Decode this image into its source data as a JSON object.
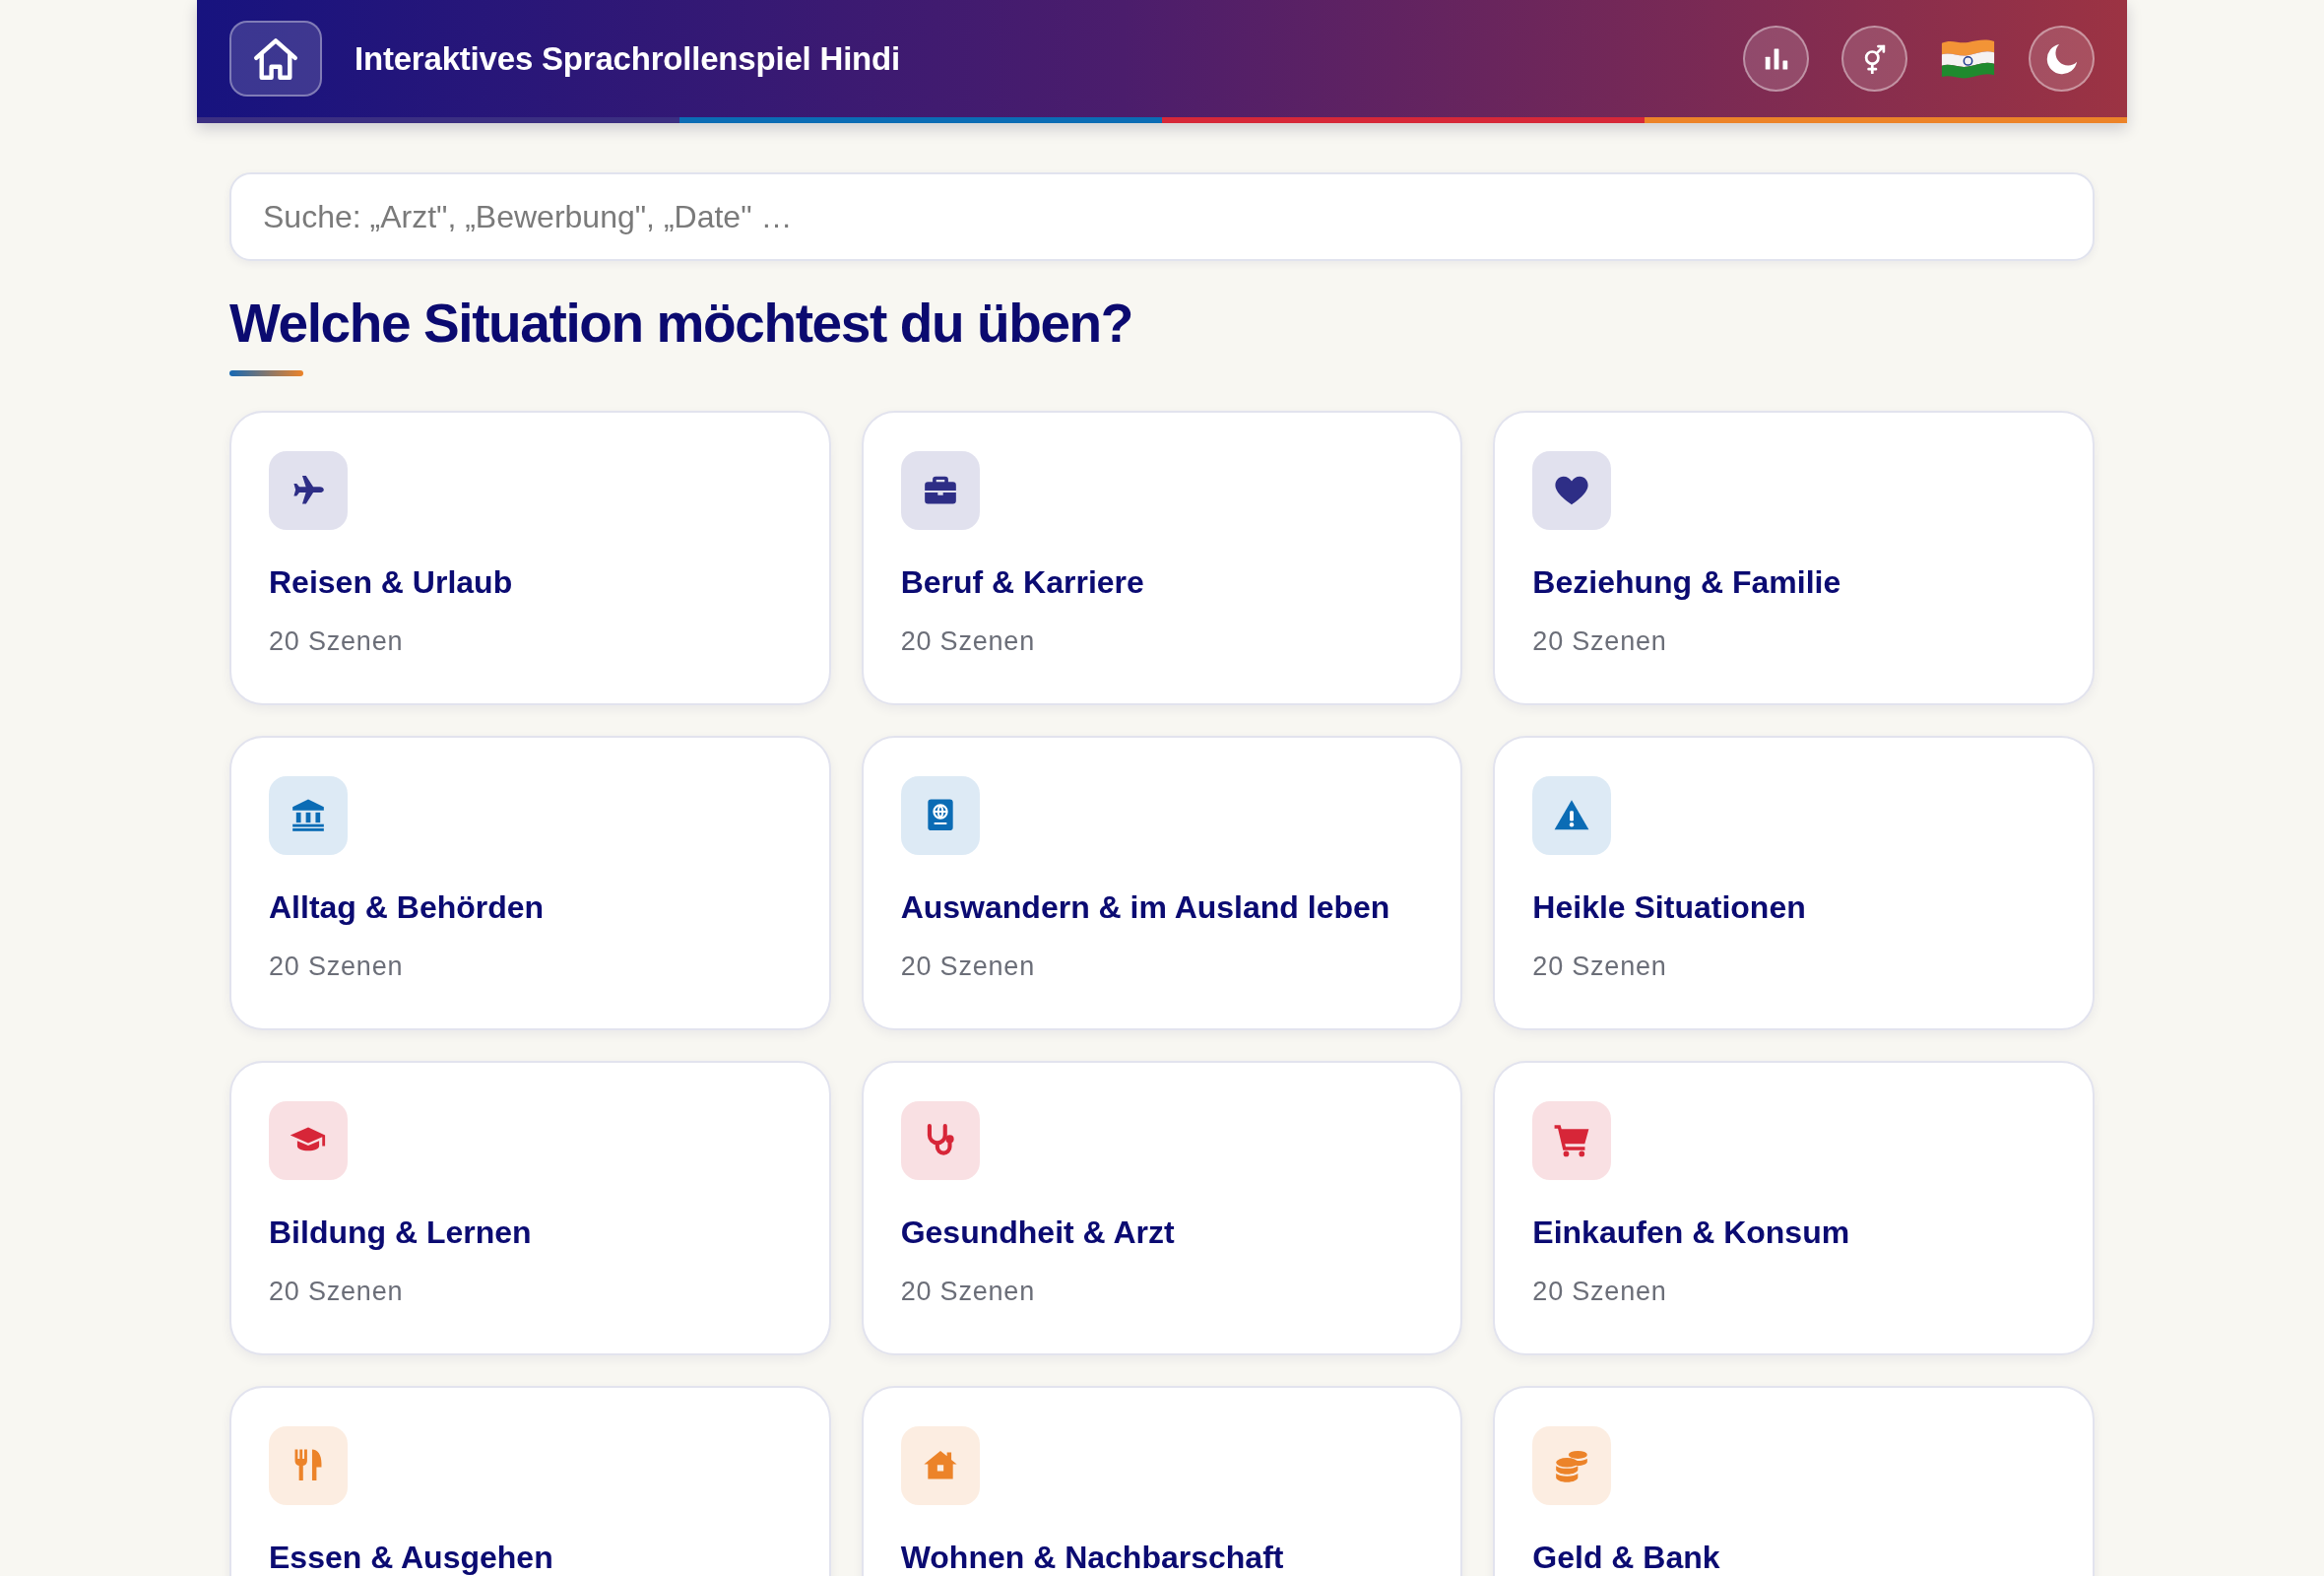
{
  "header": {
    "title": "Interaktives Sprachrollenspiel Hindi"
  },
  "search": {
    "placeholder": "Suche: „Arzt\", „Bewerbung\", „Date\" …"
  },
  "heading": "Welche Situation möchtest du üben?",
  "categories": [
    {
      "title": "Reisen & Urlaub",
      "count": "20 Szenen",
      "color": "#2e2e86"
    },
    {
      "title": "Beruf & Karriere",
      "count": "20 Szenen",
      "color": "#2e2e86"
    },
    {
      "title": "Beziehung & Familie",
      "count": "20 Szenen",
      "color": "#2e2e86"
    },
    {
      "title": "Alltag & Behörden",
      "count": "20 Szenen",
      "color": "#0b6cb5"
    },
    {
      "title": "Auswandern & im Ausland leben",
      "count": "20 Szenen",
      "color": "#0b6cb5"
    },
    {
      "title": "Heikle Situationen",
      "count": "20 Szenen",
      "color": "#0b6cb5"
    },
    {
      "title": "Bildung & Lernen",
      "count": "20 Szenen",
      "color": "#d72638"
    },
    {
      "title": "Gesundheit & Arzt",
      "count": "20 Szenen",
      "color": "#d72638"
    },
    {
      "title": "Einkaufen & Konsum",
      "count": "20 Szenen",
      "color": "#d72638"
    },
    {
      "title": "Essen & Ausgehen",
      "color": "#ec8329"
    },
    {
      "title": "Wohnen & Nachbarschaft",
      "color": "#ec8329"
    },
    {
      "title": "Geld & Bank",
      "color": "#ec8329"
    }
  ]
}
